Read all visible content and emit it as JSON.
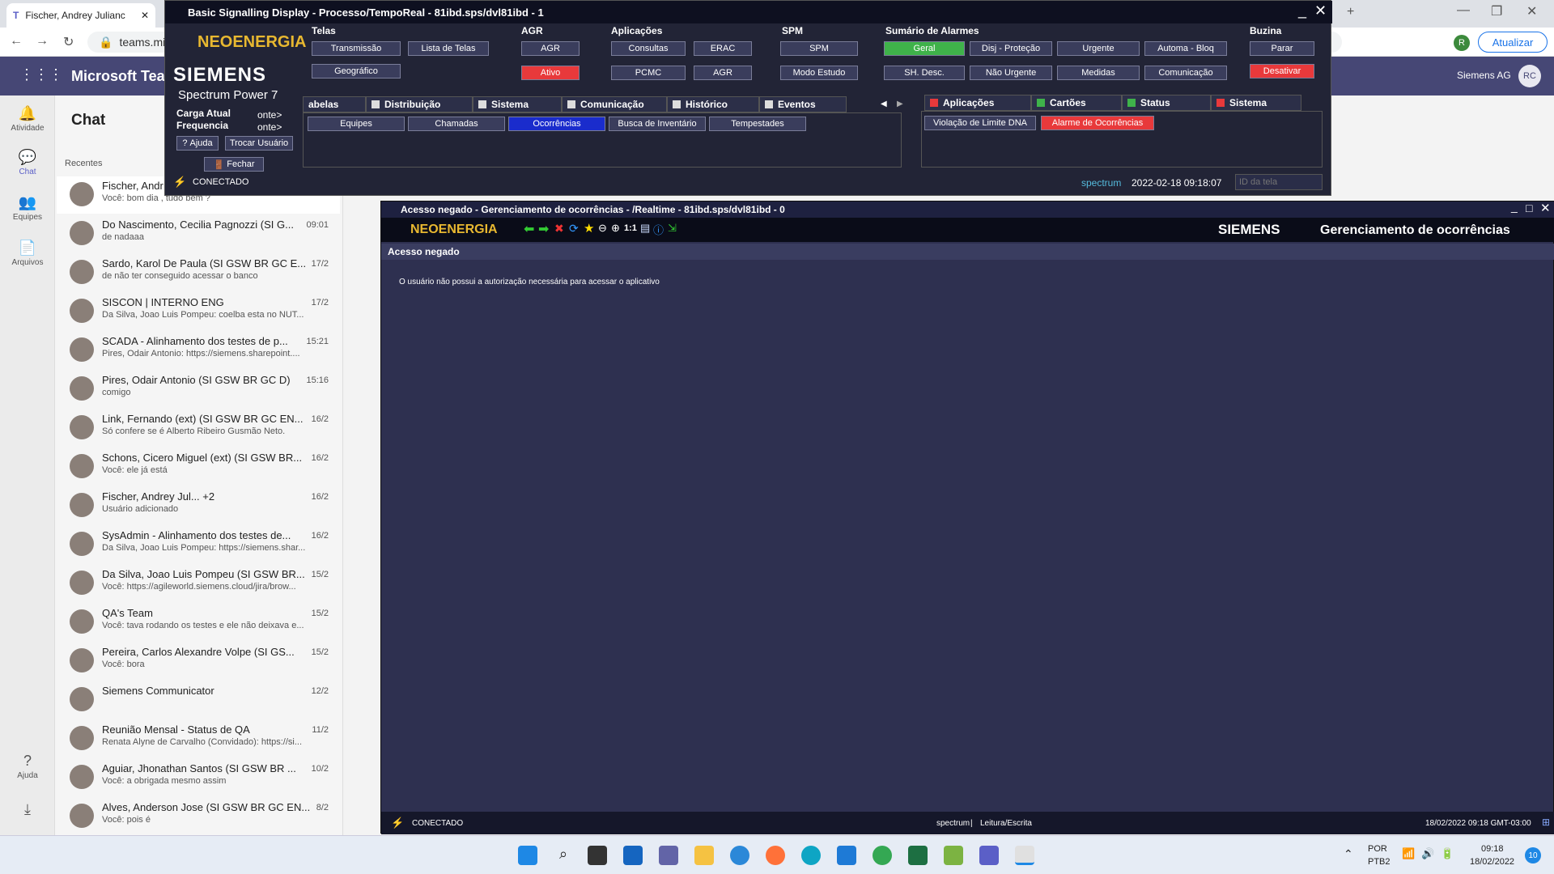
{
  "browser": {
    "tab_title": "Fischer, Andrey Julianc",
    "url": "teams.mic",
    "update_label": "Atualizar",
    "profile_initial": "R"
  },
  "teams": {
    "app_name": "Microsoft Tear",
    "org": "Siemens AG",
    "user_initials": "RC",
    "chat_title": "Chat",
    "recents_label": "Recentes",
    "rail": [
      {
        "label": "Atividade",
        "icon": "bell-icon"
      },
      {
        "label": "Chat",
        "icon": "chat-icon"
      },
      {
        "label": "Equipes",
        "icon": "teams-icon"
      },
      {
        "label": "Arquivos",
        "icon": "file-icon"
      },
      {
        "label": "Ajuda",
        "icon": "help-icon"
      }
    ],
    "chats": [
      {
        "name": "Fischer, Andr",
        "preview": "Você: bom dia , tudo bem ?",
        "time": ""
      },
      {
        "name": "Do Nascimento, Cecilia Pagnozzi (SI G...",
        "preview": "de nadaaa",
        "time": "09:01"
      },
      {
        "name": "Sardo, Karol De Paula (SI GSW BR GC E...",
        "preview": "de não ter conseguido acessar o banco",
        "time": "17/2"
      },
      {
        "name": "SISCON | INTERNO ENG",
        "preview": "Da Silva, Joao Luis Pompeu: coelba esta no NUT...",
        "time": "17/2"
      },
      {
        "name": "SCADA - Alinhamento dos testes de p...",
        "preview": "Pires, Odair Antonio: https://siemens.sharepoint....",
        "time": "15:21"
      },
      {
        "name": "Pires, Odair Antonio (SI GSW BR GC D)",
        "preview": "comigo",
        "time": "15:16"
      },
      {
        "name": "Link, Fernando (ext) (SI GSW BR GC EN...",
        "preview": "Só confere se é Alberto Ribeiro Gusmão Neto.",
        "time": "16/2"
      },
      {
        "name": "Schons, Cicero Miguel (ext) (SI GSW BR...",
        "preview": "Você: ele já está",
        "time": "16/2"
      },
      {
        "name": "Fischer, Andrey Jul... +2",
        "preview": "Usuário adicionado",
        "time": "16/2"
      },
      {
        "name": "SysAdmin - Alinhamento dos testes de...",
        "preview": "Da Silva, Joao Luis Pompeu: https://siemens.shar...",
        "time": "16/2"
      },
      {
        "name": "Da Silva, Joao Luis Pompeu (SI GSW BR...",
        "preview": "Você: https://agileworld.siemens.cloud/jira/brow...",
        "time": "15/2"
      },
      {
        "name": "QA's Team",
        "preview": "Você: tava rodando os testes e ele não deixava e...",
        "time": "15/2"
      },
      {
        "name": "Pereira, Carlos Alexandre Volpe (SI GS...",
        "preview": "Você: bora",
        "time": "15/2"
      },
      {
        "name": "Siemens Communicator",
        "preview": "",
        "time": "12/2"
      },
      {
        "name": "Reunião Mensal - Status de QA",
        "preview": "Renata Alyne de Carvalho (Convidado): https://si...",
        "time": "11/2"
      },
      {
        "name": "Aguiar, Jhonathan Santos (SI GSW BR ...",
        "preview": "Você: a obrigada mesmo assim",
        "time": "10/2"
      },
      {
        "name": "Alves, Anderson Jose (SI GSW BR GC EN...",
        "preview": "Você: pois é",
        "time": "8/2"
      }
    ]
  },
  "scada_top": {
    "title": "Basic Signalling Display - Processo/TempoReal - 81ibd.sps/dvl81ibd - 1",
    "logo": "NEOENERGIA",
    "brand": "SIEMENS",
    "product": "Spectrum Power 7",
    "carga": "Carga Atual",
    "freq": "Frequencia",
    "carga_val": "onte>",
    "freq_val": "onte>",
    "ajuda": "Ajuda",
    "trocar": "Trocar Usuário",
    "fechar": "Fechar",
    "telas": {
      "label": "Telas",
      "b1": "Transmissão",
      "b2": "Lista de Telas",
      "b3": "Geográfico"
    },
    "agr": {
      "label": "AGR",
      "b1": "AGR",
      "b2": "Ativo"
    },
    "aplic": {
      "label": "Aplicações",
      "b1": "Consultas",
      "b2": "ERAC",
      "b3": "PCMC",
      "b4": "AGR"
    },
    "spm": {
      "label": "SPM",
      "b1": "SPM",
      "b2": "Modo Estudo"
    },
    "alarmes": {
      "label": "Sumário de Alarmes",
      "b1": "Geral",
      "b2": "Disj - Proteção",
      "b3": "Urgente",
      "b4": "Automa - Bloq",
      "b5": "SH. Desc.",
      "b6": "Não Urgente",
      "b7": "Medidas",
      "b8": "Comunicação"
    },
    "buzina": {
      "label": "Buzina",
      "b1": "Parar",
      "b2": "Desativar"
    },
    "tabs": [
      "abelas",
      "Distribuição",
      "Sistema",
      "Comunicação",
      "Histórico",
      "Eventos"
    ],
    "subtabs": [
      "Equipes",
      "Chamadas",
      "Ocorrências",
      "Busca de Inventário",
      "Tempestades"
    ],
    "rtabs": [
      "Aplicações",
      "Cartões",
      "Status",
      "Sistema"
    ],
    "rbtns": [
      "Violação de Limite DNA",
      "Alarme de Ocorrências"
    ],
    "status": "CONECTADO",
    "host": "spectrum",
    "datetime": "2022-02-18 09:18:07",
    "id_placeholder": "ID da tela",
    "colors": {
      "red": "#e8393b",
      "green": "#3fb24a",
      "blue": "#1a2ccc"
    }
  },
  "scada_main": {
    "title": "Acesso negado - Gerenciamento de ocorrências - /Realtime - 81ibd.sps/dvl81ibd - 0",
    "logo": "NEOENERGIA",
    "brand": "SIEMENS",
    "app": "Gerenciamento de ocorrências",
    "zoom": "1:1",
    "access_header": "Acesso negado",
    "message": "O usuário não possui a autorização necessária para acessar o aplicativo",
    "status": "CONECTADO",
    "host": "spectrum",
    "mode": "Leitura/Escrita",
    "datetime": "18/02/2022 09:18 GMT-03:00"
  },
  "taskbar": {
    "lang": "POR",
    "layout": "PTB2",
    "time": "09:18",
    "date": "18/02/2022",
    "badge": "10"
  }
}
